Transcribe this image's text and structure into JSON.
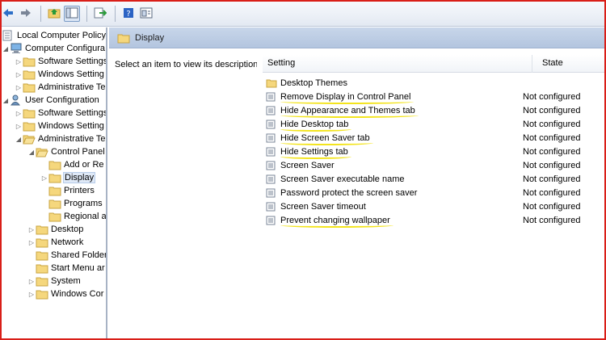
{
  "toolbar": {
    "buttons": [
      "back-arrow-icon",
      "forward-arrow-icon",
      "up-folder-icon",
      "show-hide-tree-icon",
      "export-list-icon",
      "help-icon",
      "properties-icon"
    ]
  },
  "tree": {
    "items": [
      {
        "label": "Local Computer Policy"
      },
      {
        "label": "Computer Configura"
      },
      {
        "label": "Software Settings"
      },
      {
        "label": "Windows Setting"
      },
      {
        "label": "Administrative Te"
      },
      {
        "label": "User Configuration"
      },
      {
        "label": "Software Settings"
      },
      {
        "label": "Windows Setting"
      },
      {
        "label": "Administrative Te"
      },
      {
        "label": "Control Panel"
      },
      {
        "label": "Add or Re"
      },
      {
        "label": "Display"
      },
      {
        "label": "Printers"
      },
      {
        "label": "Programs"
      },
      {
        "label": "Regional a"
      },
      {
        "label": "Desktop"
      },
      {
        "label": "Network"
      },
      {
        "label": "Shared Folder"
      },
      {
        "label": "Start Menu ar"
      },
      {
        "label": "System"
      },
      {
        "label": "Windows Cor"
      }
    ]
  },
  "header": {
    "title": "Display"
  },
  "description": "Select an item to view its description.",
  "list": {
    "columns": {
      "setting": "Setting",
      "state": "State"
    },
    "rows": [
      {
        "name": "Desktop Themes",
        "state": ""
      },
      {
        "name": "Remove Display in Control Panel",
        "state": "Not configured"
      },
      {
        "name": "Hide Appearance and Themes tab",
        "state": "Not configured"
      },
      {
        "name": "Hide Desktop tab",
        "state": "Not configured"
      },
      {
        "name": "Hide Screen Saver tab",
        "state": "Not configured"
      },
      {
        "name": "Hide Settings tab",
        "state": "Not configured"
      },
      {
        "name": "Screen Saver",
        "state": "Not configured"
      },
      {
        "name": "Screen Saver executable name",
        "state": "Not configured"
      },
      {
        "name": "Password protect the screen saver",
        "state": "Not configured"
      },
      {
        "name": "Screen Saver timeout",
        "state": "Not configured"
      },
      {
        "name": "Prevent changing wallpaper",
        "state": "Not configured"
      }
    ]
  },
  "colors": {
    "frame_border": "#d91e18",
    "highlight_underline": "#f3e41c",
    "header_band": "#b3c5df"
  }
}
